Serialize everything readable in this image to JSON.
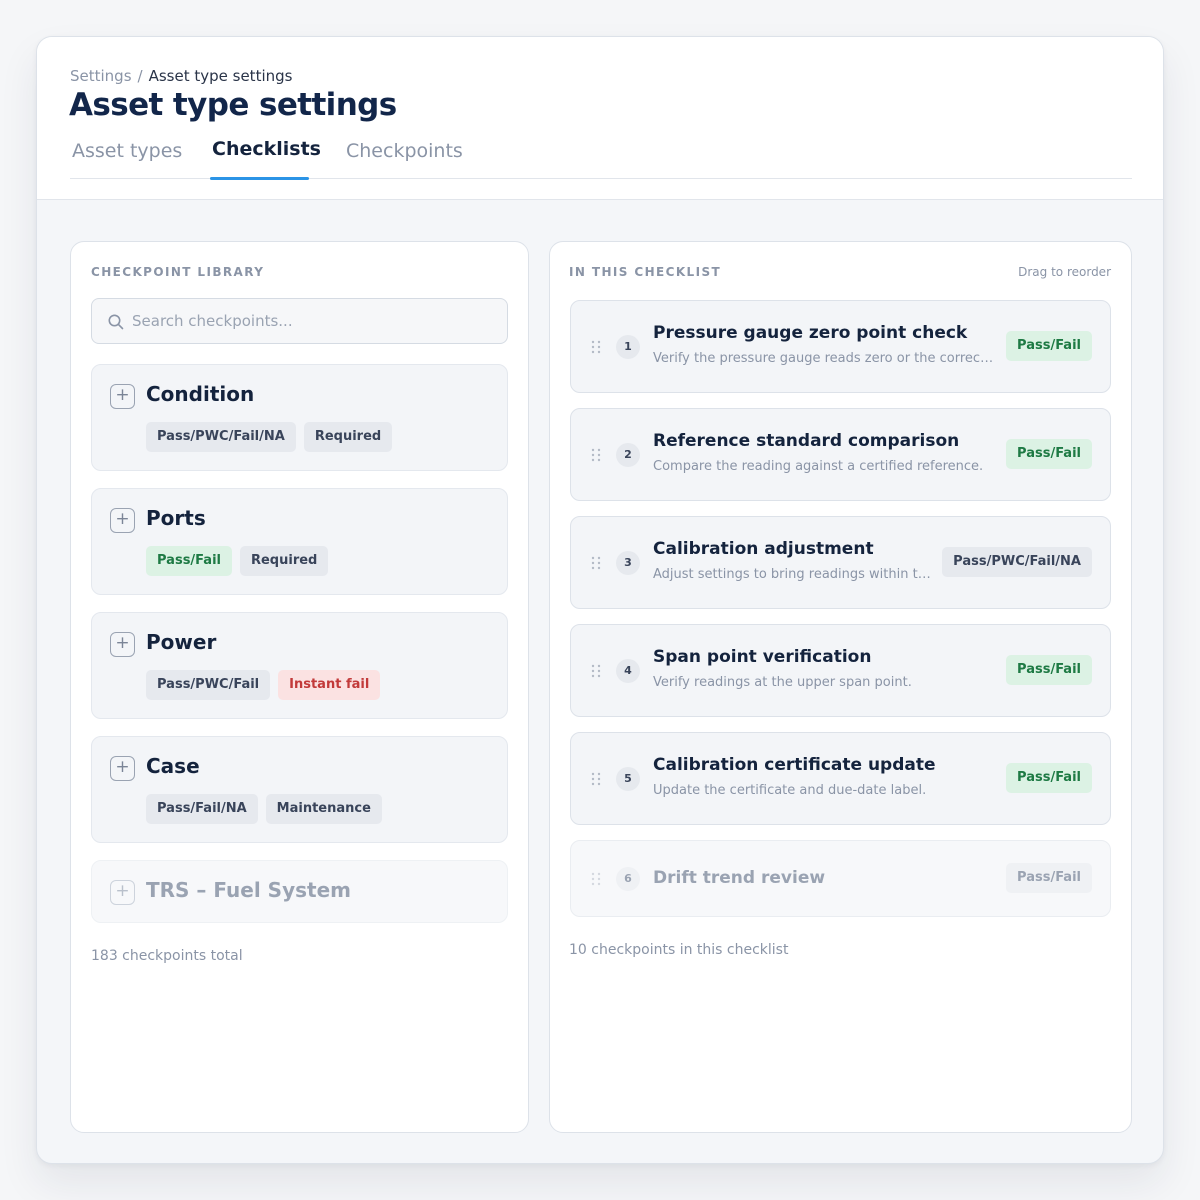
{
  "breadcrumb": {
    "root": "Settings",
    "separator": "/",
    "current": "Asset type settings"
  },
  "page": {
    "title": "Asset type settings"
  },
  "tabs": [
    {
      "label": "Asset types",
      "active": false
    },
    {
      "label": "Checklists",
      "active": true
    },
    {
      "label": "Checkpoints",
      "active": false
    }
  ],
  "library": {
    "heading": "CHECKPOINT LIBRARY",
    "search": {
      "placeholder": "Search checkpoints...",
      "value": ""
    },
    "items": [
      {
        "name": "Condition",
        "tags": [
          {
            "label": "Pass/PWC/Fail/NA",
            "style": "neutral"
          },
          {
            "label": "Required",
            "style": "neutral"
          }
        ]
      },
      {
        "name": "Ports",
        "tags": [
          {
            "label": "Pass/Fail",
            "style": "pass"
          },
          {
            "label": "Required",
            "style": "neutral"
          }
        ]
      },
      {
        "name": "Power",
        "tags": [
          {
            "label": "Pass/PWC/Fail",
            "style": "neutral"
          },
          {
            "label": "Instant fail",
            "style": "fail"
          }
        ]
      },
      {
        "name": "Case",
        "tags": [
          {
            "label": "Pass/Fail/NA",
            "style": "neutral"
          },
          {
            "label": "Maintenance",
            "style": "neutral"
          }
        ]
      },
      {
        "name": "TRS – Fuel System",
        "tags": []
      }
    ],
    "footer": "183 checkpoints total"
  },
  "checklist": {
    "heading": "IN THIS CHECKLIST",
    "hint": "Drag to reorder",
    "items": [
      {
        "number": "1",
        "title": "Pressure gauge zero point check",
        "description": "Verify the pressure gauge reads zero or the correct value at rest.",
        "tag": "Pass/Fail",
        "tag_style": "pass"
      },
      {
        "number": "2",
        "title": "Reference standard comparison",
        "description": "Compare the reading against a certified reference.",
        "tag": "Pass/Fail",
        "tag_style": "pass"
      },
      {
        "number": "3",
        "title": "Calibration adjustment",
        "description": "Adjust settings to bring readings within tolerance.",
        "tag": "Pass/PWC/Fail/NA",
        "tag_style": "neutral"
      },
      {
        "number": "4",
        "title": "Span point verification",
        "description": "Verify readings at the upper span point.",
        "tag": "Pass/Fail",
        "tag_style": "pass"
      },
      {
        "number": "5",
        "title": "Calibration certificate update",
        "description": "Update the certificate and due-date label.",
        "tag": "Pass/Fail",
        "tag_style": "pass"
      },
      {
        "number": "6",
        "title": "Drift trend review",
        "description": "",
        "tag": "Pass/Fail",
        "tag_style": "muted"
      }
    ],
    "footer": "10 checkpoints in this checklist"
  },
  "colors": {
    "accent": "#2b94e6",
    "title": "#12264a",
    "pass_bg": "#dcf2e4",
    "pass_text": "#1e7a44",
    "fail_bg": "#fbe2e2",
    "fail_text": "#c23a3a"
  },
  "icons": {
    "search": "search-icon",
    "add": "plus-icon",
    "drag": "drag-handle-icon"
  }
}
